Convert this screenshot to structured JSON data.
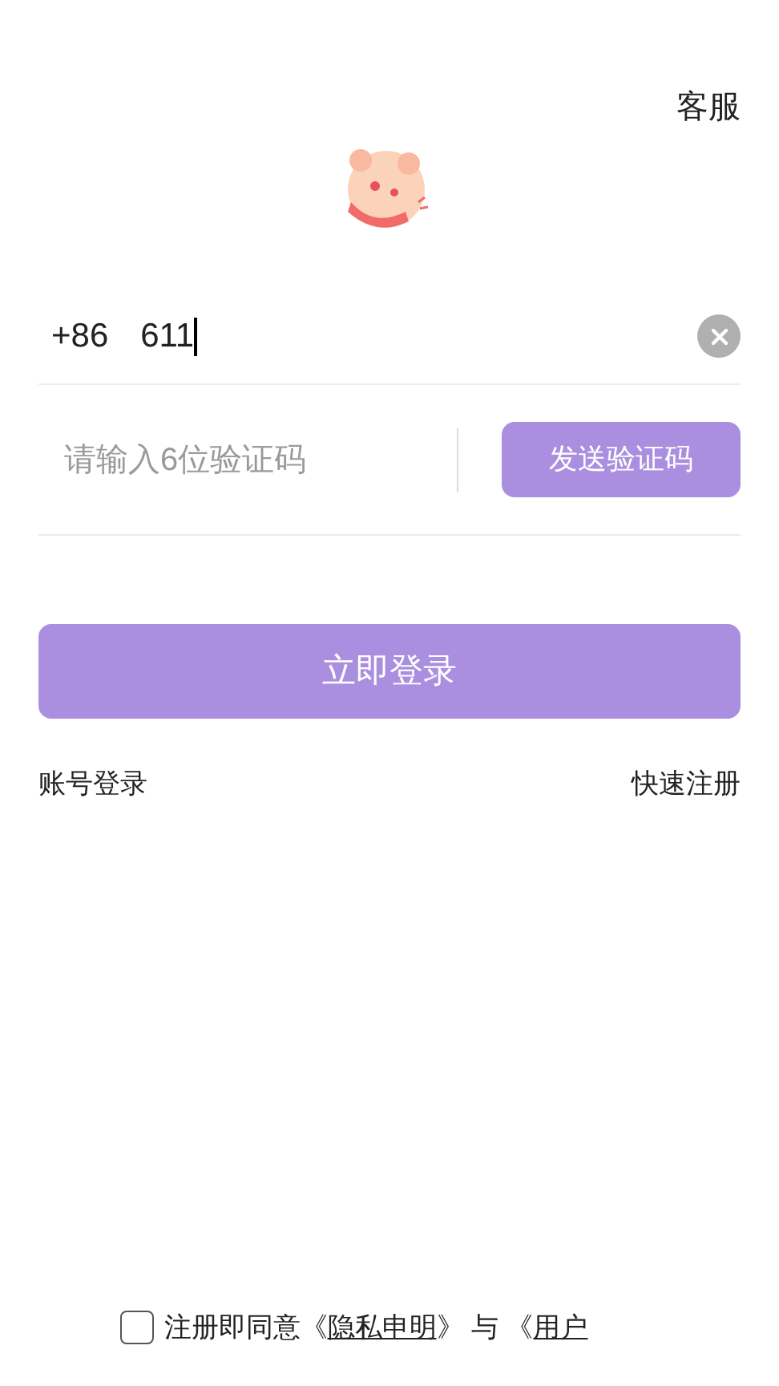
{
  "header": {
    "service_link": "客服"
  },
  "phone": {
    "country_code": "+86",
    "value": "611"
  },
  "code": {
    "placeholder": "请输入6位验证码",
    "send_button": "发送验证码"
  },
  "login_button": "立即登录",
  "links": {
    "account_login": "账号登录",
    "quick_register": "快速注册"
  },
  "agreement": {
    "checked": false,
    "text": "注册即同意",
    "open1": "《",
    "privacy_link": "隐私申明",
    "close1": "》",
    "joiner": "与",
    "open2": "《",
    "user_link": "用户"
  }
}
